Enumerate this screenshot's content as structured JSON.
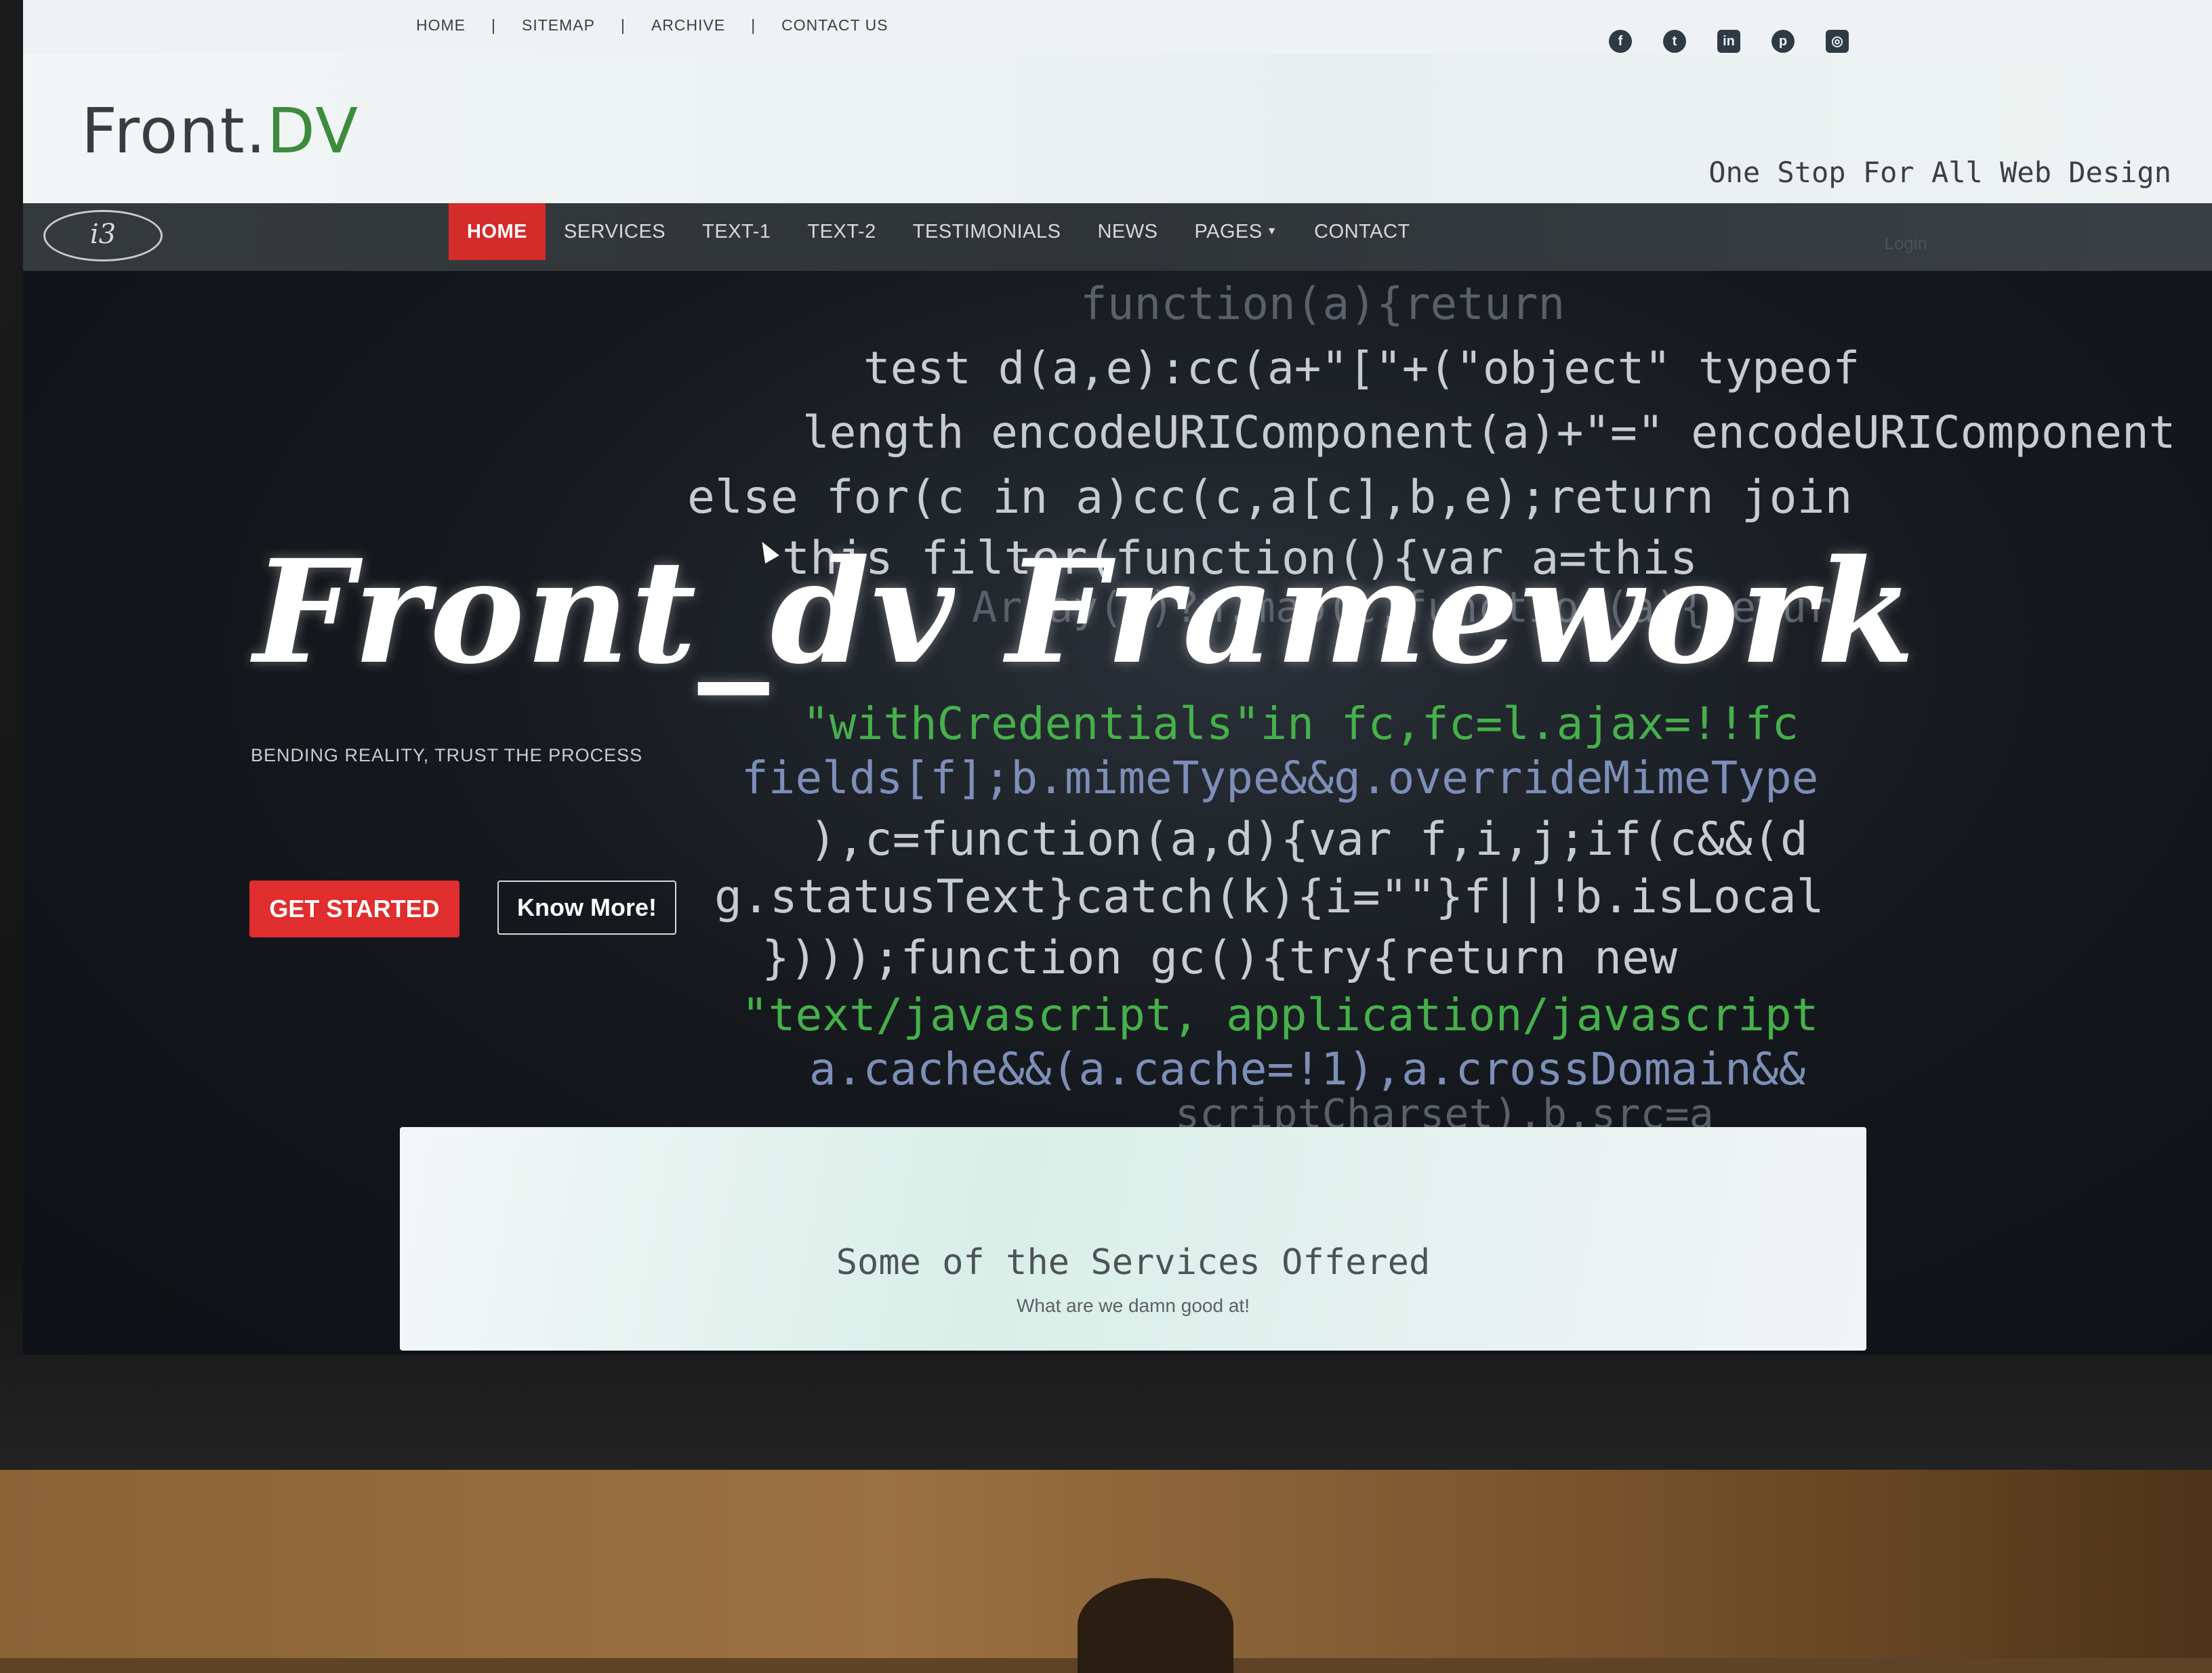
{
  "top_links": [
    "HOME",
    "SITEMAP",
    "ARCHIVE",
    "CONTACT US"
  ],
  "social_icons": [
    "facebook-icon",
    "twitter-icon",
    "linkedin-icon",
    "pinterest-icon",
    "instagram-icon"
  ],
  "brand": {
    "name_plain": "Front.",
    "name_accent": "DV",
    "tagline": "One Stop For All Web Design",
    "accent_color": "#3d8b3d"
  },
  "logo_text": "i3",
  "nav": {
    "items": [
      "HOME",
      "SERVICES",
      "TEXT-1",
      "TEXT-2",
      "TESTIMONIALS",
      "NEWS",
      "PAGES",
      "CONTACT"
    ],
    "active": "HOME",
    "active_color": "#d42b2b",
    "login": "Login"
  },
  "hero": {
    "title": "Front_dv Framework",
    "subtitle": "BENDING REALITY, TRUST THE PROCESS",
    "cta_primary": "GET STARTED",
    "cta_secondary": "Know More!",
    "primary_color": "#e02d2d"
  },
  "code_lines": [
    "function(a){return",
    "test  d(a,e):cc(a+\"[\"+(\"object\"  typeof",
    "length encodeURIComponent(a)+\"=\" encodeURIComponent",
    "else for(c in a)cc(c,a[c],b,e);return  join",
    "this filter(function(){var a=this",
    "Array(c)?n.map(c,function(a){return",
    "\"withCredentials\"in fc,fc=l.ajax=!!fc",
    "fields[f];b.mimeType&&g.overrideMimeType",
    "),c=function(a,d){var f,i,j;if(c&&(d",
    "g.statusText}catch(k){i=\"\"}f||!b.isLocal",
    "})));function gc(){try{return new",
    "\"text/javascript, application/javascript",
    "a.cache&&(a.cache=!1),a.crossDomain&&",
    "scriptCharset),b.src=a"
  ],
  "services": {
    "title": "Some of the Services Offered",
    "subtitle": "What are we damn good at!"
  }
}
